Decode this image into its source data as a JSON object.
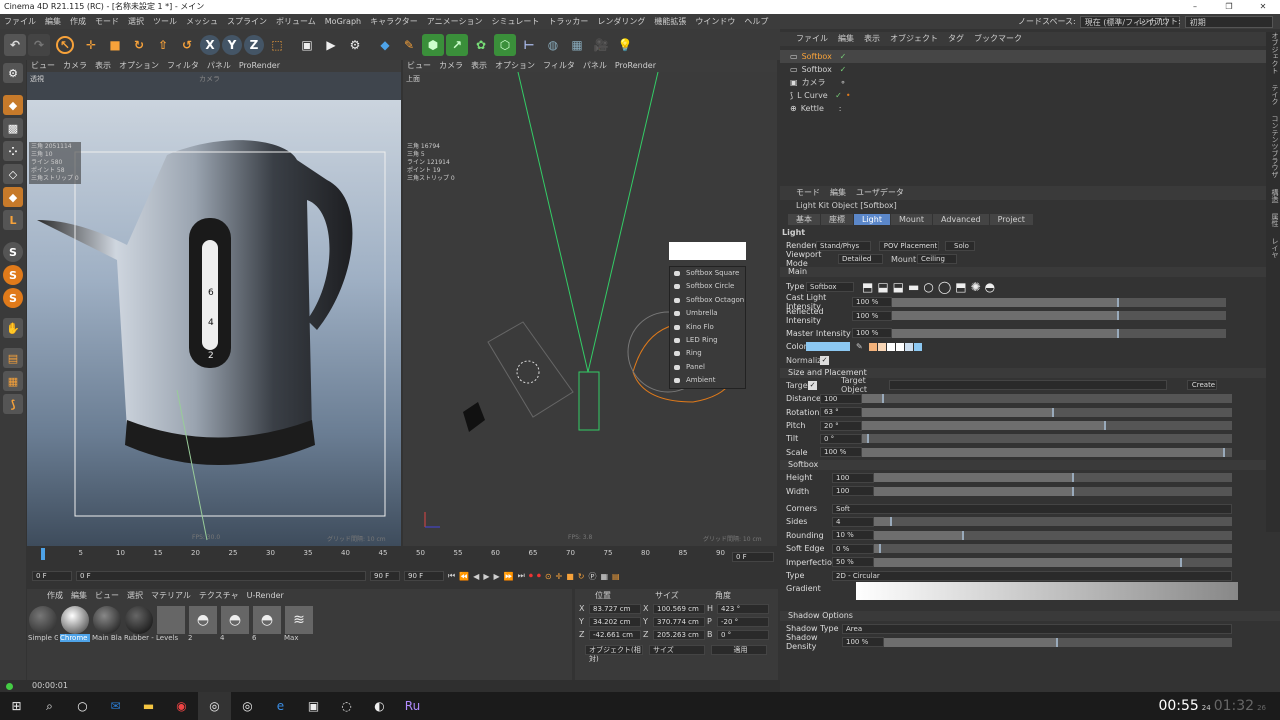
{
  "window": {
    "title": "Cinema 4D R21.115 (RC) - [名称未設定 1 *] - メイン"
  },
  "menu": {
    "items": [
      "ファイル",
      "編集",
      "作成",
      "モード",
      "選択",
      "ツール",
      "メッシュ",
      "スプライン",
      "ボリューム",
      "MoGraph",
      "キャラクター",
      "アニメーション",
      "シミュレート",
      "トラッカー",
      "レンダリング",
      "機能拡張",
      "ウインドウ",
      "ヘルプ"
    ],
    "nodespace_label": "ノードスペース:",
    "nodespace_value": "現在 (標準/フィジカル)",
    "layout_label": "レイアウト:",
    "layout_value": "初期"
  },
  "viewport1": {
    "menu": [
      "ビュー",
      "カメラ",
      "表示",
      "オプション",
      "フィルタ",
      "パネル",
      "ProRender"
    ],
    "mode": "透視",
    "camera": "カメラ",
    "stats": [
      "三角 2051114",
      "三角 10",
      "ライン 580",
      "ポイント 58",
      "三角ストリップ 0"
    ],
    "fps": "FPS: 30.0",
    "grid": "グリッド間隔: 10 cm"
  },
  "viewport2": {
    "menu": [
      "ビュー",
      "カメラ",
      "表示",
      "オプション",
      "フィルタ",
      "パネル",
      "ProRender"
    ],
    "mode": "上面",
    "stats": [
      "三角 16794",
      "三角 5",
      "ライン 121914",
      "ポイント 19",
      "三角ストリップ 0"
    ],
    "fps": "FPS: 3.8",
    "grid": "グリッド間隔: 10 cm"
  },
  "context_menu": {
    "items": [
      "Softbox Square",
      "Softbox Circle",
      "Softbox Octagon",
      "Umbrella",
      "Kino Flo",
      "LED Ring",
      "Ring",
      "Panel",
      "Ambient"
    ]
  },
  "object_manager": {
    "menu": [
      "ファイル",
      "編集",
      "表示",
      "オブジェクト",
      "タグ",
      "ブックマーク"
    ],
    "objects": [
      "Softbox",
      "Softbox",
      "カメラ",
      "L Curve",
      "Kettle"
    ]
  },
  "attributes": {
    "menu": [
      "モード",
      "編集",
      "ユーザデータ"
    ],
    "title": "Light Kit Object [Softbox]",
    "tabs": [
      "基本",
      "座標",
      "Light",
      "Mount",
      "Advanced",
      "Project"
    ],
    "active_tab": "Light",
    "section_light": "Light",
    "renderer_label": "Renderer",
    "renderer_value": "Stand/Phys",
    "pov_button": "POV Placement",
    "solo_button": "Solo",
    "viewport_mode_label": "Viewport Mode",
    "viewport_mode_value": "Detailed",
    "mount_label": "Mount",
    "mount_value": "Ceiling",
    "section_main": "Main",
    "type_label": "Type",
    "type_value": "Softbox",
    "cast_label": "Cast Light Intensity",
    "cast_value": "100 %",
    "cast_fill": 0.68,
    "reflected_label": "Reflected Intensity",
    "reflected_value": "100 %",
    "reflected_fill": 0.68,
    "master_label": "Master Intensity",
    "master_value": "100 %",
    "master_fill": 0.68,
    "color_label": "Color",
    "normalize_label": "Normalize",
    "section_size": "Size and Placement",
    "target_label": "Target",
    "target_object_label": "Target Object",
    "create_button": "Create",
    "distance_label": "Distance",
    "distance_value": "100",
    "distance_fill": 0.06,
    "rotation_label": "Rotation",
    "rotation_value": "63 °",
    "rotation_fill": 0.52,
    "pitch_label": "Pitch",
    "pitch_value": "20 °",
    "pitch_fill": 0.66,
    "tilt_label": "Tilt",
    "tilt_value": "0 °",
    "tilt_fill": 0.02,
    "scale_label": "Scale",
    "scale_value": "100 %",
    "scale_fill": 0.98,
    "section_softbox": "Softbox",
    "height_label": "Height",
    "height_value": "100",
    "height_fill": 0.56,
    "width_label": "Width",
    "width_value": "100",
    "width_fill": 0.56,
    "corners_label": "Corners",
    "corners_value": "Soft",
    "sides_label": "Sides",
    "sides_value": "4",
    "sides_fill": 0.05,
    "rounding_label": "Rounding",
    "rounding_value": "10 %",
    "rounding_fill": 0.25,
    "softedge_label": "Soft Edge",
    "softedge_value": "0 %",
    "softedge_fill": 0.02,
    "imperfections_label": "Imperfections",
    "imperfections_value": "50 %",
    "imperfections_fill": 0.86,
    "type2_label": "Type",
    "type2_value": "2D - Circular",
    "gradient_label": "Gradient",
    "section_shadow": "Shadow Options",
    "shadowtype_label": "Shadow Type",
    "shadowtype_value": "Area",
    "shadowdensity_label": "Shadow Density",
    "shadowdensity_value": "100 %",
    "shadowdensity_fill": 0.5
  },
  "timeline": {
    "ticks": [
      "0",
      "5",
      "10",
      "15",
      "20",
      "25",
      "30",
      "35",
      "40",
      "45",
      "50",
      "55",
      "60",
      "65",
      "70",
      "75",
      "80",
      "85",
      "90"
    ],
    "current": "0 F",
    "start": "0 F",
    "start2": "0 F",
    "end": "90 F",
    "end2": "90 F"
  },
  "materials": {
    "menu": [
      "作成",
      "編集",
      "ビュー",
      "選択",
      "マテリアル",
      "テクスチャ",
      "U-Render"
    ],
    "items": [
      "Simple G",
      "Chrome",
      "Main Bla",
      "Rubber -",
      "Levels",
      "2",
      "4",
      "6",
      "Max"
    ]
  },
  "coords": {
    "headers": [
      "位置",
      "サイズ",
      "角度"
    ],
    "rows": [
      [
        "X",
        "83.727 cm",
        "X",
        "100.569 cm",
        "H",
        "423 °"
      ],
      [
        "Y",
        "34.202 cm",
        "Y",
        "370.774 cm",
        "P",
        "-20 °"
      ],
      [
        "Z",
        "-42.661 cm",
        "Z",
        "205.263 cm",
        "B",
        "0 °"
      ]
    ],
    "mode1": "オブジェクト(相対)",
    "mode2": "サイズ",
    "apply": "適用"
  },
  "status": {
    "time": "00:00:01"
  },
  "taskbar": {
    "clock_main": "00:55",
    "clock_frame": "24",
    "clock_total": "01:32",
    "clock_total_frame": "26"
  },
  "right_vertical_tabs": [
    "オブジェクト",
    "テイク",
    "コンテンツブラウザ",
    "構造",
    "属性",
    "レイヤ"
  ]
}
